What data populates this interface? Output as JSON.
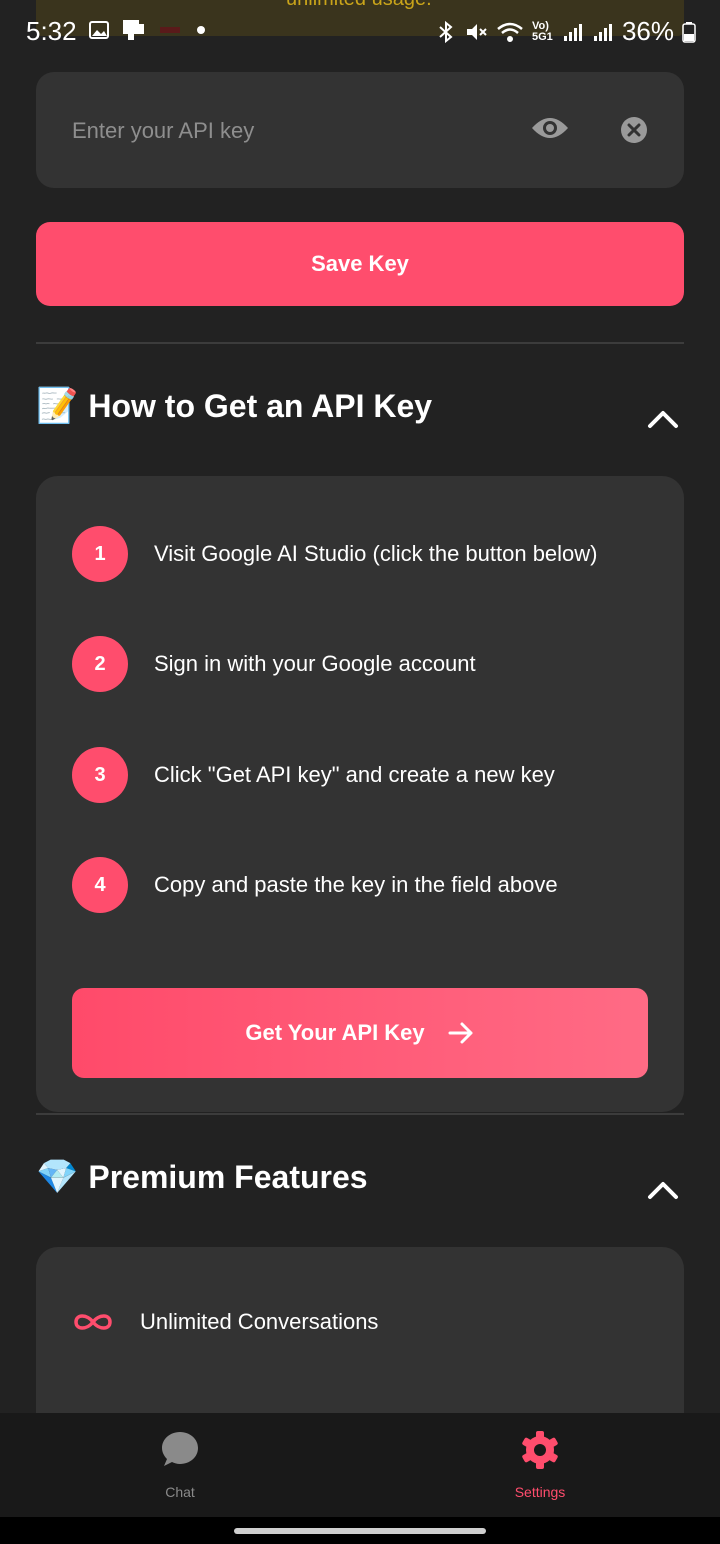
{
  "status_bar": {
    "time": "5:32",
    "banner_text": "unlimited usage.",
    "battery": "36%",
    "network_label": "Vo) 5G1"
  },
  "api_key": {
    "placeholder": "Enter your API key",
    "value": "",
    "visibility_icon": "eye-icon",
    "clear_icon": "clear-icon"
  },
  "save_button": {
    "label": "Save Key"
  },
  "how_to": {
    "emoji": "📝",
    "title": "How to Get an API Key",
    "steps": [
      {
        "number": "1",
        "text": "Visit Google AI Studio (click the button below)"
      },
      {
        "number": "2",
        "text": "Sign in with your Google account"
      },
      {
        "number": "3",
        "text": "Click \"Get API key\" and create a new key"
      },
      {
        "number": "4",
        "text": "Copy and paste the key in the field above"
      }
    ],
    "button_label": "Get Your API Key"
  },
  "premium": {
    "emoji": "💎",
    "title": "Premium Features",
    "features": [
      {
        "icon": "infinity-icon",
        "label": "Unlimited Conversations"
      }
    ]
  },
  "bottom_nav": {
    "items": [
      {
        "label": "Chat",
        "icon": "chat-icon",
        "active": false
      },
      {
        "label": "Settings",
        "icon": "gear-icon",
        "active": true
      }
    ]
  },
  "colors": {
    "accent": "#ff4d6d",
    "background": "#222222",
    "card": "#333333",
    "nav_inactive": "#8a8a8a"
  }
}
